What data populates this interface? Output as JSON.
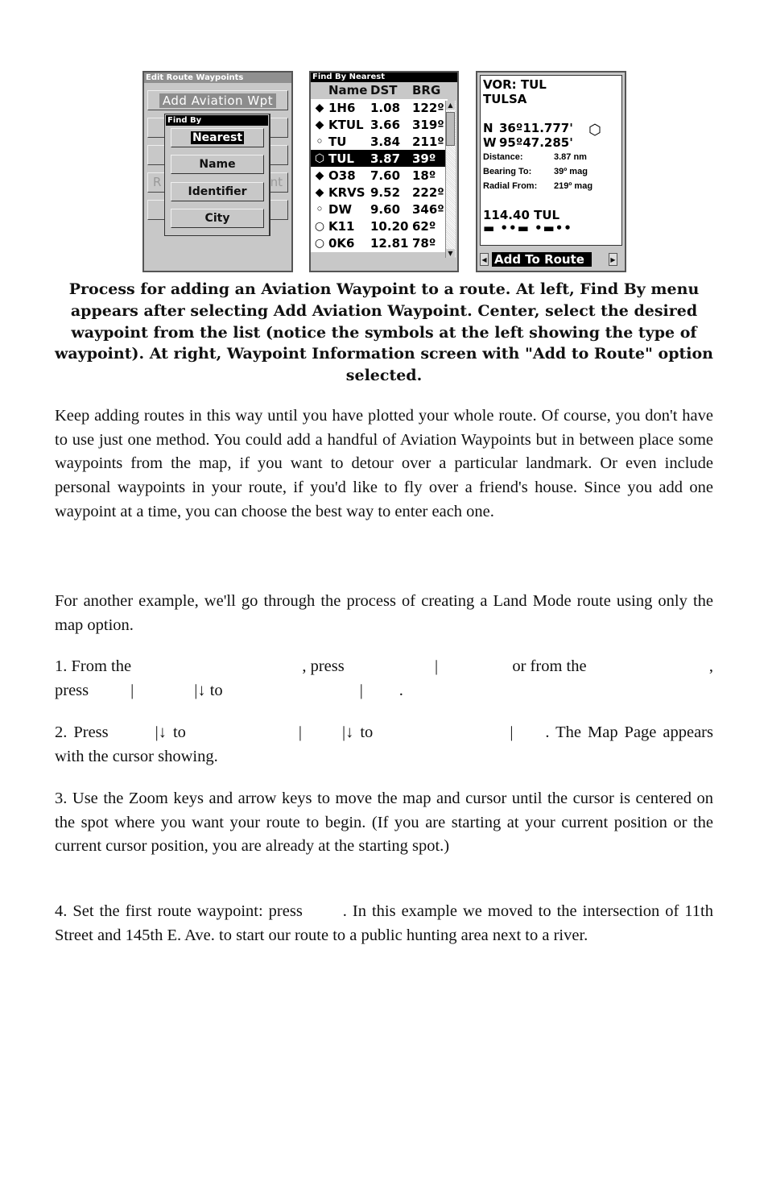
{
  "figure": {
    "screen_edit_route": {
      "title": "Edit Route Waypoints",
      "add_button": "Add Aviation Wpt",
      "ghost_left": "R",
      "ghost_right": "nt",
      "find_by_menu": {
        "title": "Find By",
        "options": [
          "Nearest",
          "Name",
          "Identifier",
          "City"
        ],
        "selected": "Nearest"
      }
    },
    "screen_find_nearest": {
      "title": "Find By Nearest",
      "columns": [
        "Name",
        "DST",
        "BRG"
      ],
      "rows": [
        {
          "icon": "airport-icon",
          "glyph": "◆",
          "name": "1H6",
          "dst": "1.08",
          "brg": "122º"
        },
        {
          "icon": "airport-icon",
          "glyph": "◆",
          "name": "KTUL",
          "dst": "3.66",
          "brg": "319º"
        },
        {
          "icon": "ndb-icon",
          "glyph": "◦",
          "name": "TU",
          "dst": "3.84",
          "brg": "211º"
        },
        {
          "icon": "vor-icon",
          "glyph": "⬡",
          "name": "TUL",
          "dst": "3.87",
          "brg": "39º"
        },
        {
          "icon": "airport-icon",
          "glyph": "◆",
          "name": "O38",
          "dst": "7.60",
          "brg": "18º"
        },
        {
          "icon": "airport-icon",
          "glyph": "◆",
          "name": "KRVS",
          "dst": "9.52",
          "brg": "222º"
        },
        {
          "icon": "ndb-icon",
          "glyph": "◦",
          "name": "DW",
          "dst": "9.60",
          "brg": "346º"
        },
        {
          "icon": "private-airport-icon",
          "glyph": "○",
          "name": "K11",
          "dst": "10.20",
          "brg": "62º"
        },
        {
          "icon": "private-airport-icon",
          "glyph": "○",
          "name": "0K6",
          "dst": "12.81",
          "brg": "78º"
        }
      ],
      "selected_index": 3
    },
    "screen_waypoint_info": {
      "type_line": "VOR: TUL",
      "name_line": "TULSA",
      "lat_hemi": "N",
      "lat": "36º11.777'",
      "lon_hemi": "W",
      "lon": "95º47.285'",
      "fields": [
        {
          "label": "Distance:",
          "value": "3.87 nm"
        },
        {
          "label": "Bearing To:",
          "value": "39º mag"
        },
        {
          "label": "Radial From:",
          "value": "219º mag"
        }
      ],
      "frequency": "114.40 TUL",
      "morse": "▬ ••▬ •▬••",
      "option": "Add To Route"
    }
  },
  "caption": "Process for adding an Aviation Waypoint to a route. At left, Find By menu appears after selecting Add Aviation Waypoint. Center, select the desired waypoint from the list (notice the symbols at the left showing the type of waypoint). At right, Waypoint Information screen with \"Add to Route\" option selected.",
  "paragraphs": {
    "p1": "Keep adding routes in this way until you have plotted your whole route. Of course, you don't have to use just one method. You could add a handful of Aviation Waypoints but in between place some waypoints from the map, if you want to detour over a particular landmark. Or even include personal waypoints in your route, if you'd like to fly over a friend's house. Since you add one waypoint at a time, you can choose the best way to enter each one.",
    "p2": "For another example, we'll go through the process of creating a Land Mode route using only the map option.",
    "p3": {
      "a": "1. From the",
      "b": ", press",
      "c": "|",
      "d": "or from the",
      "e": ",",
      "f": "press",
      "g": "|",
      "h": "|↓ to",
      "i": "|",
      "j": "."
    },
    "p4": {
      "a": "2. Press",
      "b": "|↓ to",
      "c": "|",
      "d": "|↓ to",
      "e": "|",
      "f": ". The Map Page appears with the cursor showing."
    },
    "p5": "3. Use the Zoom keys and arrow keys to move the map and cursor until the cursor is centered on the spot where you want your route to begin. (If you are starting at your current position or the current cursor position, you are already at the starting spot.)",
    "p6": {
      "a": "4. Set the first route waypoint: press",
      "b": ". In this example we moved to the intersection of 11th Street and 145th E. Ave. to start our route to a public hunting area next to a river."
    }
  }
}
